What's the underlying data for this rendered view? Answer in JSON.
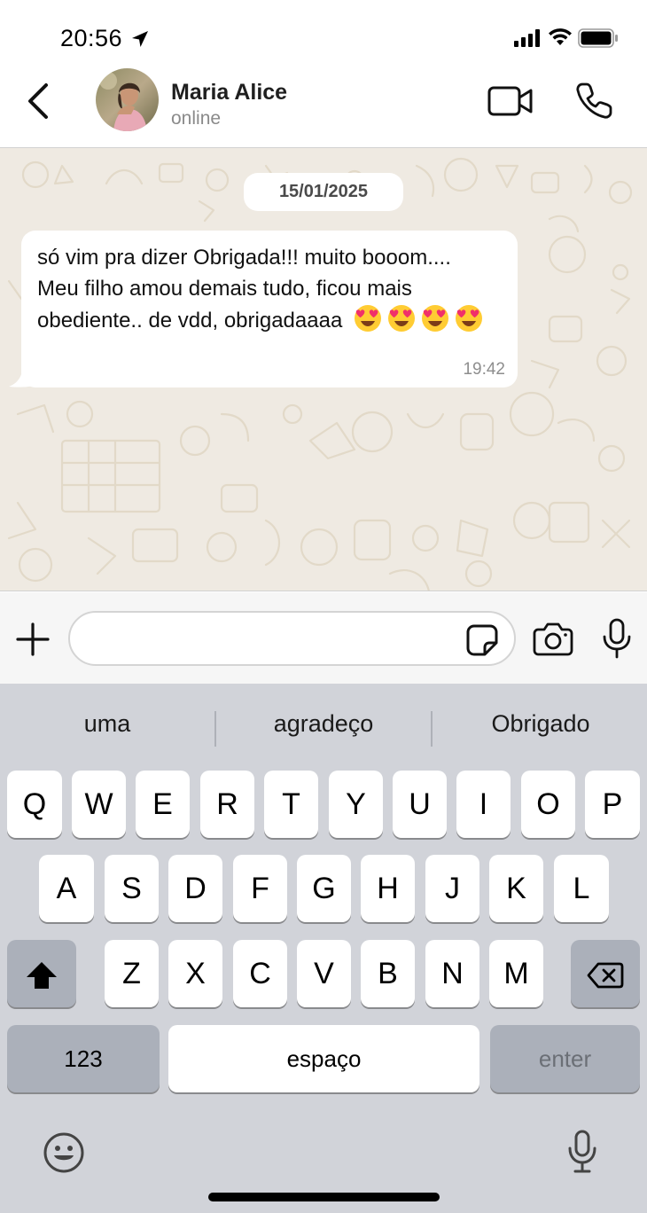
{
  "status_bar": {
    "time": "20:56",
    "icons": [
      "location-arrow-icon",
      "cellular-signal-icon",
      "wifi-icon",
      "battery-icon"
    ]
  },
  "header": {
    "contact_name": "Maria Alice",
    "contact_status": "online",
    "icons": [
      "back-chevron-icon",
      "video-camera-icon",
      "phone-icon"
    ]
  },
  "chat": {
    "date": "15/01/2025",
    "messages": [
      {
        "text": "só vim pra dizer Obrigada!!! muito booom.... Meu filho amou demais tudo, ficou mais obediente.. de vdd, obrigadaaaa",
        "emojis": "😍😍😍😍",
        "time": "19:42"
      }
    ]
  },
  "input_bar": {
    "placeholder": "",
    "value": "",
    "icons": [
      "plus-icon",
      "sticker-icon",
      "camera-icon",
      "microphone-icon"
    ]
  },
  "keyboard": {
    "suggestions": [
      "uma",
      "agradeço",
      "Obrigado"
    ],
    "row1": [
      "Q",
      "W",
      "E",
      "R",
      "T",
      "Y",
      "U",
      "I",
      "O",
      "P"
    ],
    "row2": [
      "A",
      "S",
      "D",
      "F",
      "G",
      "H",
      "J",
      "K",
      "L"
    ],
    "row3": [
      "Z",
      "X",
      "C",
      "V",
      "B",
      "N",
      "M"
    ],
    "numbers_label": "123",
    "space_label": "espaço",
    "enter_label": "enter",
    "icons": [
      "shift-icon",
      "backspace-icon",
      "emoji-icon",
      "dictation-mic-icon"
    ]
  },
  "colors": {
    "chat_background": "#efeae2",
    "bubble": "#ffffff",
    "keyboard_background": "#d1d3d9",
    "dark_key": "#abb0ba"
  }
}
